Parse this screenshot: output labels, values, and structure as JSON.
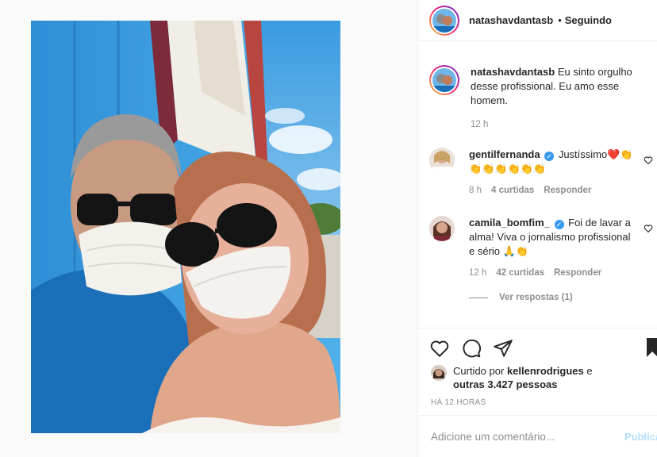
{
  "post": {
    "author": "natashavdantasb",
    "follow_separator": "•",
    "follow_state": "Seguindo"
  },
  "caption": {
    "username": "natashavdantasb",
    "text": "Eu sinto orgulho desse profissional. Eu amo esse homem.",
    "time": "12 h"
  },
  "comments": [
    {
      "username": "gentilfernanda",
      "verified": true,
      "text": "Justíssimo❤️👏👏👏👏👏👏👏",
      "time": "8 h",
      "likes": "4 curtidas",
      "reply": "Responder"
    },
    {
      "username": "camila_bomfim_",
      "verified": true,
      "text": "Foi de lavar a alma! Viva o jornalismo profissional e sério 🙏👏",
      "time": "12 h",
      "likes": "42 curtidas",
      "reply": "Responder"
    }
  ],
  "view_replies": "Ver respostas (1)",
  "likes": {
    "prefix": "Curtido por",
    "user": "kellenrodrigues",
    "connector": "e",
    "others": "outras 3.427 pessoas"
  },
  "timestamp": "HÁ 12 HORAS",
  "add_comment": {
    "placeholder": "Adicione um comentário...",
    "publish": "Publicar"
  },
  "icons": {
    "like": "heart-icon",
    "comment": "comment-bubble-icon",
    "share": "paper-plane-icon",
    "save": "bookmark-icon",
    "comment_like": "heart-icon",
    "verified": "verified-badge-icon"
  },
  "colors": {
    "verified": "#3897f0",
    "muted": "#8e8e8e",
    "publish_disabled": "#b2dffc",
    "text": "#262626"
  }
}
